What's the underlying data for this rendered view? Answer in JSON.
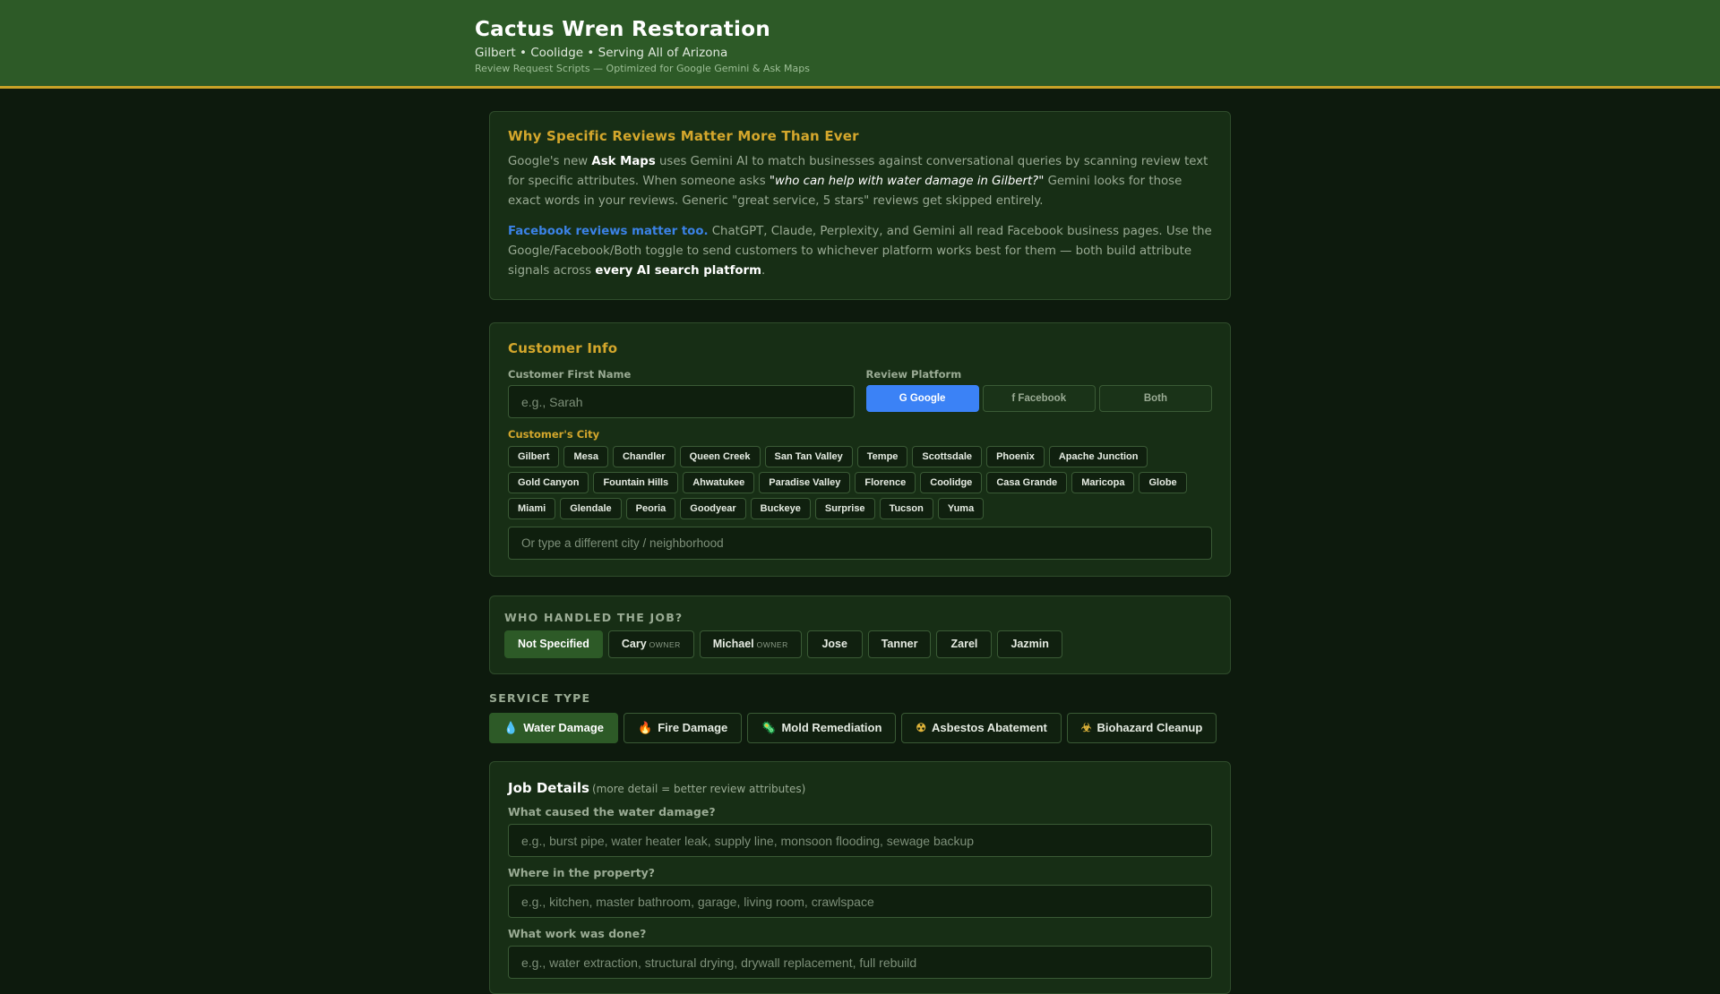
{
  "header": {
    "title": "Cactus Wren Restoration",
    "subtitle": "Gilbert • Coolidge • Serving All of Arizona",
    "tagline": "Review Request Scripts — Optimized for Google Gemini & Ask Maps"
  },
  "why": {
    "title": "Why Specific Reviews Matter More Than Ever",
    "p1_a": "Google's new ",
    "p1_b": "Ask Maps",
    "p1_c": " uses Gemini AI to match businesses against conversational queries by scanning review text for specific attributes. When someone asks ",
    "p1_d": "\"who can help with water damage in Gilbert?\"",
    "p1_e": " Gemini looks for those exact words in your reviews. Generic \"great service, 5 stars\" reviews get skipped entirely.",
    "p2_a": "Facebook reviews matter too.",
    "p2_b": " ChatGPT, Claude, Perplexity, and Gemini all read Facebook business pages. Use the Google/Facebook/Both toggle to send customers to whichever platform works best for them — both build attribute signals across ",
    "p2_c": "every AI search platform",
    "p2_d": "."
  },
  "customer": {
    "title": "Customer Info",
    "name_label": "Customer First Name",
    "name_placeholder": "e.g., Sarah",
    "platform_label": "Review Platform",
    "platforms": [
      "G Google",
      "f Facebook",
      "Both"
    ],
    "city_label": "Customer's City",
    "cities": [
      "Gilbert",
      "Mesa",
      "Chandler",
      "Queen Creek",
      "San Tan Valley",
      "Tempe",
      "Scottsdale",
      "Phoenix",
      "Apache Junction",
      "Gold Canyon",
      "Fountain Hills",
      "Ahwatukee",
      "Paradise Valley",
      "Florence",
      "Coolidge",
      "Casa Grande",
      "Maricopa",
      "Globe",
      "Miami",
      "Glendale",
      "Peoria",
      "Goodyear",
      "Buckeye",
      "Surprise",
      "Tucson",
      "Yuma"
    ],
    "other_city_placeholder": "Or type a different city / neighborhood"
  },
  "who": {
    "title": "WHO HANDLED THE JOB?",
    "techs": [
      {
        "name": "Not Specified",
        "role": ""
      },
      {
        "name": "Cary",
        "role": "OWNER"
      },
      {
        "name": "Michael",
        "role": "OWNER"
      },
      {
        "name": "Jose",
        "role": ""
      },
      {
        "name": "Tanner",
        "role": ""
      },
      {
        "name": "Zarel",
        "role": ""
      },
      {
        "name": "Jazmin",
        "role": ""
      }
    ]
  },
  "service": {
    "title": "SERVICE TYPE",
    "types": [
      {
        "icon": "💧",
        "label": "Water Damage"
      },
      {
        "icon": "🔥",
        "label": "Fire Damage"
      },
      {
        "icon": "🦠",
        "label": "Mold Remediation"
      },
      {
        "icon": "☢",
        "label": "Asbestos Abatement"
      },
      {
        "icon": "☣",
        "label": "Biohazard Cleanup"
      }
    ]
  },
  "job": {
    "title": "Job Details",
    "note": "(more detail = better review attributes)",
    "q1_label": "What caused the water damage?",
    "q1_placeholder": "e.g., burst pipe, water heater leak, supply line, monsoon flooding, sewage backup",
    "q2_label": "Where in the property?",
    "q2_placeholder": "e.g., kitchen, master bathroom, garage, living room, crawlspace",
    "q3_label": "What work was done?",
    "q3_placeholder": "e.g., water extraction, structural drying, drywall replacement, full rebuild"
  },
  "colors": {
    "header_bg": "#2d5a27",
    "accent_gold": "#d4a72c",
    "google_blue": "#3b82f6",
    "page_bg": "#0d1a0d"
  }
}
